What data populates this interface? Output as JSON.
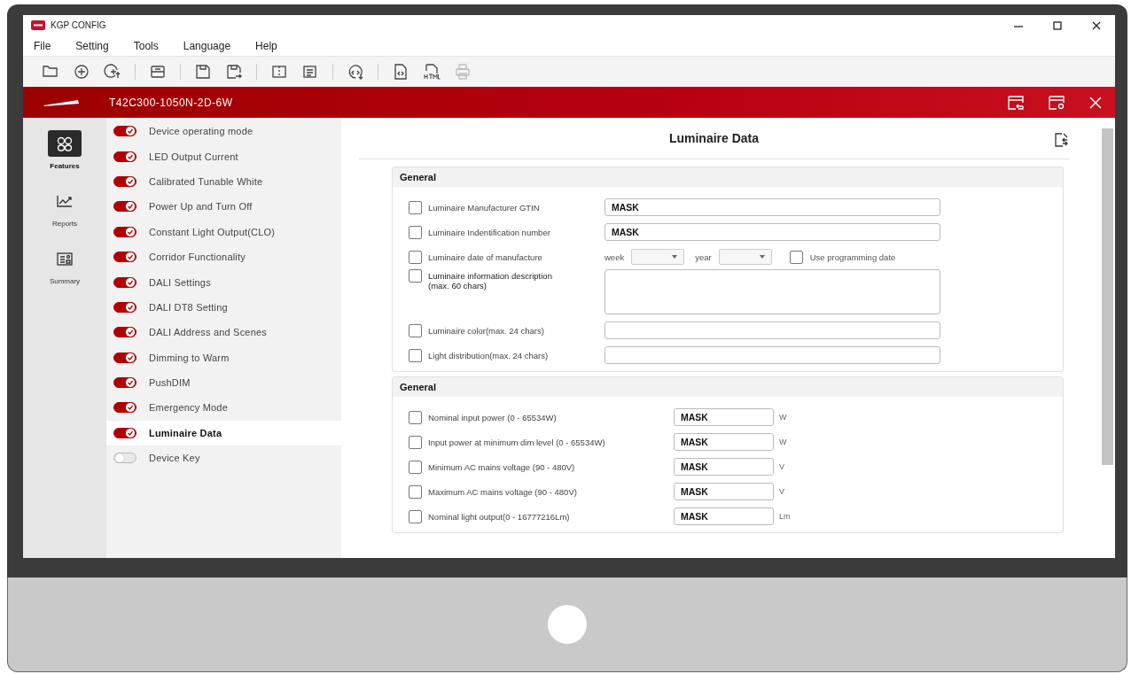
{
  "window": {
    "title": "KGP CONFIG"
  },
  "menu": [
    "File",
    "Setting",
    "Tools",
    "Language",
    "Help"
  ],
  "device_bar": {
    "title": "T42C300-1050N-2D-6W"
  },
  "nav": [
    {
      "label": "Features",
      "selected": true
    },
    {
      "label": "Reports",
      "selected": false
    },
    {
      "label": "Summary",
      "selected": false
    }
  ],
  "features": [
    {
      "label": "Device operating mode",
      "on": true,
      "selected": false
    },
    {
      "label": "LED Output Current",
      "on": true,
      "selected": false
    },
    {
      "label": "Calibrated Tunable White",
      "on": true,
      "selected": false
    },
    {
      "label": "Power Up and Turn Off",
      "on": true,
      "selected": false
    },
    {
      "label": "Constant Light Output(CLO)",
      "on": true,
      "selected": false
    },
    {
      "label": "Corridor Functionality",
      "on": true,
      "selected": false
    },
    {
      "label": "DALI Settings",
      "on": true,
      "selected": false
    },
    {
      "label": "DALI DT8 Setting",
      "on": true,
      "selected": false
    },
    {
      "label": "DALI Address and Scenes",
      "on": true,
      "selected": false
    },
    {
      "label": "Dimming to Warm",
      "on": true,
      "selected": false
    },
    {
      "label": "PushDIM",
      "on": true,
      "selected": false
    },
    {
      "label": "Emergency Mode",
      "on": true,
      "selected": false
    },
    {
      "label": "Luminaire Data",
      "on": true,
      "selected": true
    },
    {
      "label": "Device Key",
      "on": false,
      "selected": false
    }
  ],
  "panel": {
    "title": "Luminaire Data",
    "sections": [
      {
        "title": "General",
        "rows": [
          {
            "kind": "text",
            "label": "Luminaire Manufacturer GTIN",
            "checked": false,
            "value": "MASK"
          },
          {
            "kind": "text",
            "label": "Luminaire Indentification number",
            "checked": false,
            "value": "MASK"
          },
          {
            "kind": "date",
            "label": "Luminaire date of manufacture",
            "checked": false,
            "week_label": "week",
            "year_label": "year",
            "option_label": "Use programming date",
            "option_checked": false
          },
          {
            "kind": "textarea",
            "label": "Luminaire information description",
            "note": "(max. 60 chars)",
            "checked": false
          },
          {
            "kind": "text",
            "label": "Luminaire color(max. 24 chars)",
            "checked": false
          },
          {
            "kind": "text",
            "label": "Light distribution(max. 24 chars)",
            "checked": false
          }
        ]
      },
      {
        "title": "General",
        "rows": [
          {
            "kind": "unit",
            "label": "Nominal input power (0 - 65534W)",
            "checked": false,
            "value": "MASK",
            "unit": "W"
          },
          {
            "kind": "unit",
            "label": "Input power at minimum dim level (0 - 65534W)",
            "checked": false,
            "value": "MASK",
            "unit": "W"
          },
          {
            "kind": "unit",
            "label": "Minimum AC mains voltage (90 - 480V)",
            "checked": false,
            "value": "MASK",
            "unit": "V"
          },
          {
            "kind": "unit",
            "label": "Maximum AC mains voltage (90 - 480V)",
            "checked": false,
            "value": "MASK",
            "unit": "V"
          },
          {
            "kind": "unit",
            "label": "Nominal light output(0 - 16777216Lm)",
            "checked": false,
            "value": "MASK",
            "unit": "Lm"
          }
        ]
      }
    ]
  }
}
